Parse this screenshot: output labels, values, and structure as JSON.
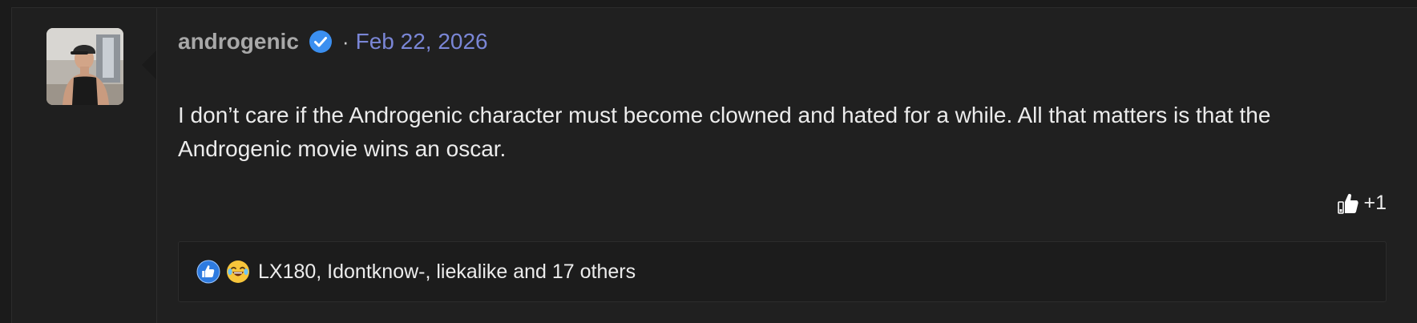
{
  "post": {
    "username": "androgenic",
    "separator": "·",
    "date": "Feb 22, 2026",
    "message": "I don’t care if the Androgenic character must become clowned and hated for a while. All that matters is that the Androgenic movie wins an oscar.",
    "vote_count": "+1",
    "reactions_text": "LX180, Idontknow-, liekalike and 17 others",
    "verified_color": "#3b8ff0",
    "date_color": "#7a86d6"
  }
}
